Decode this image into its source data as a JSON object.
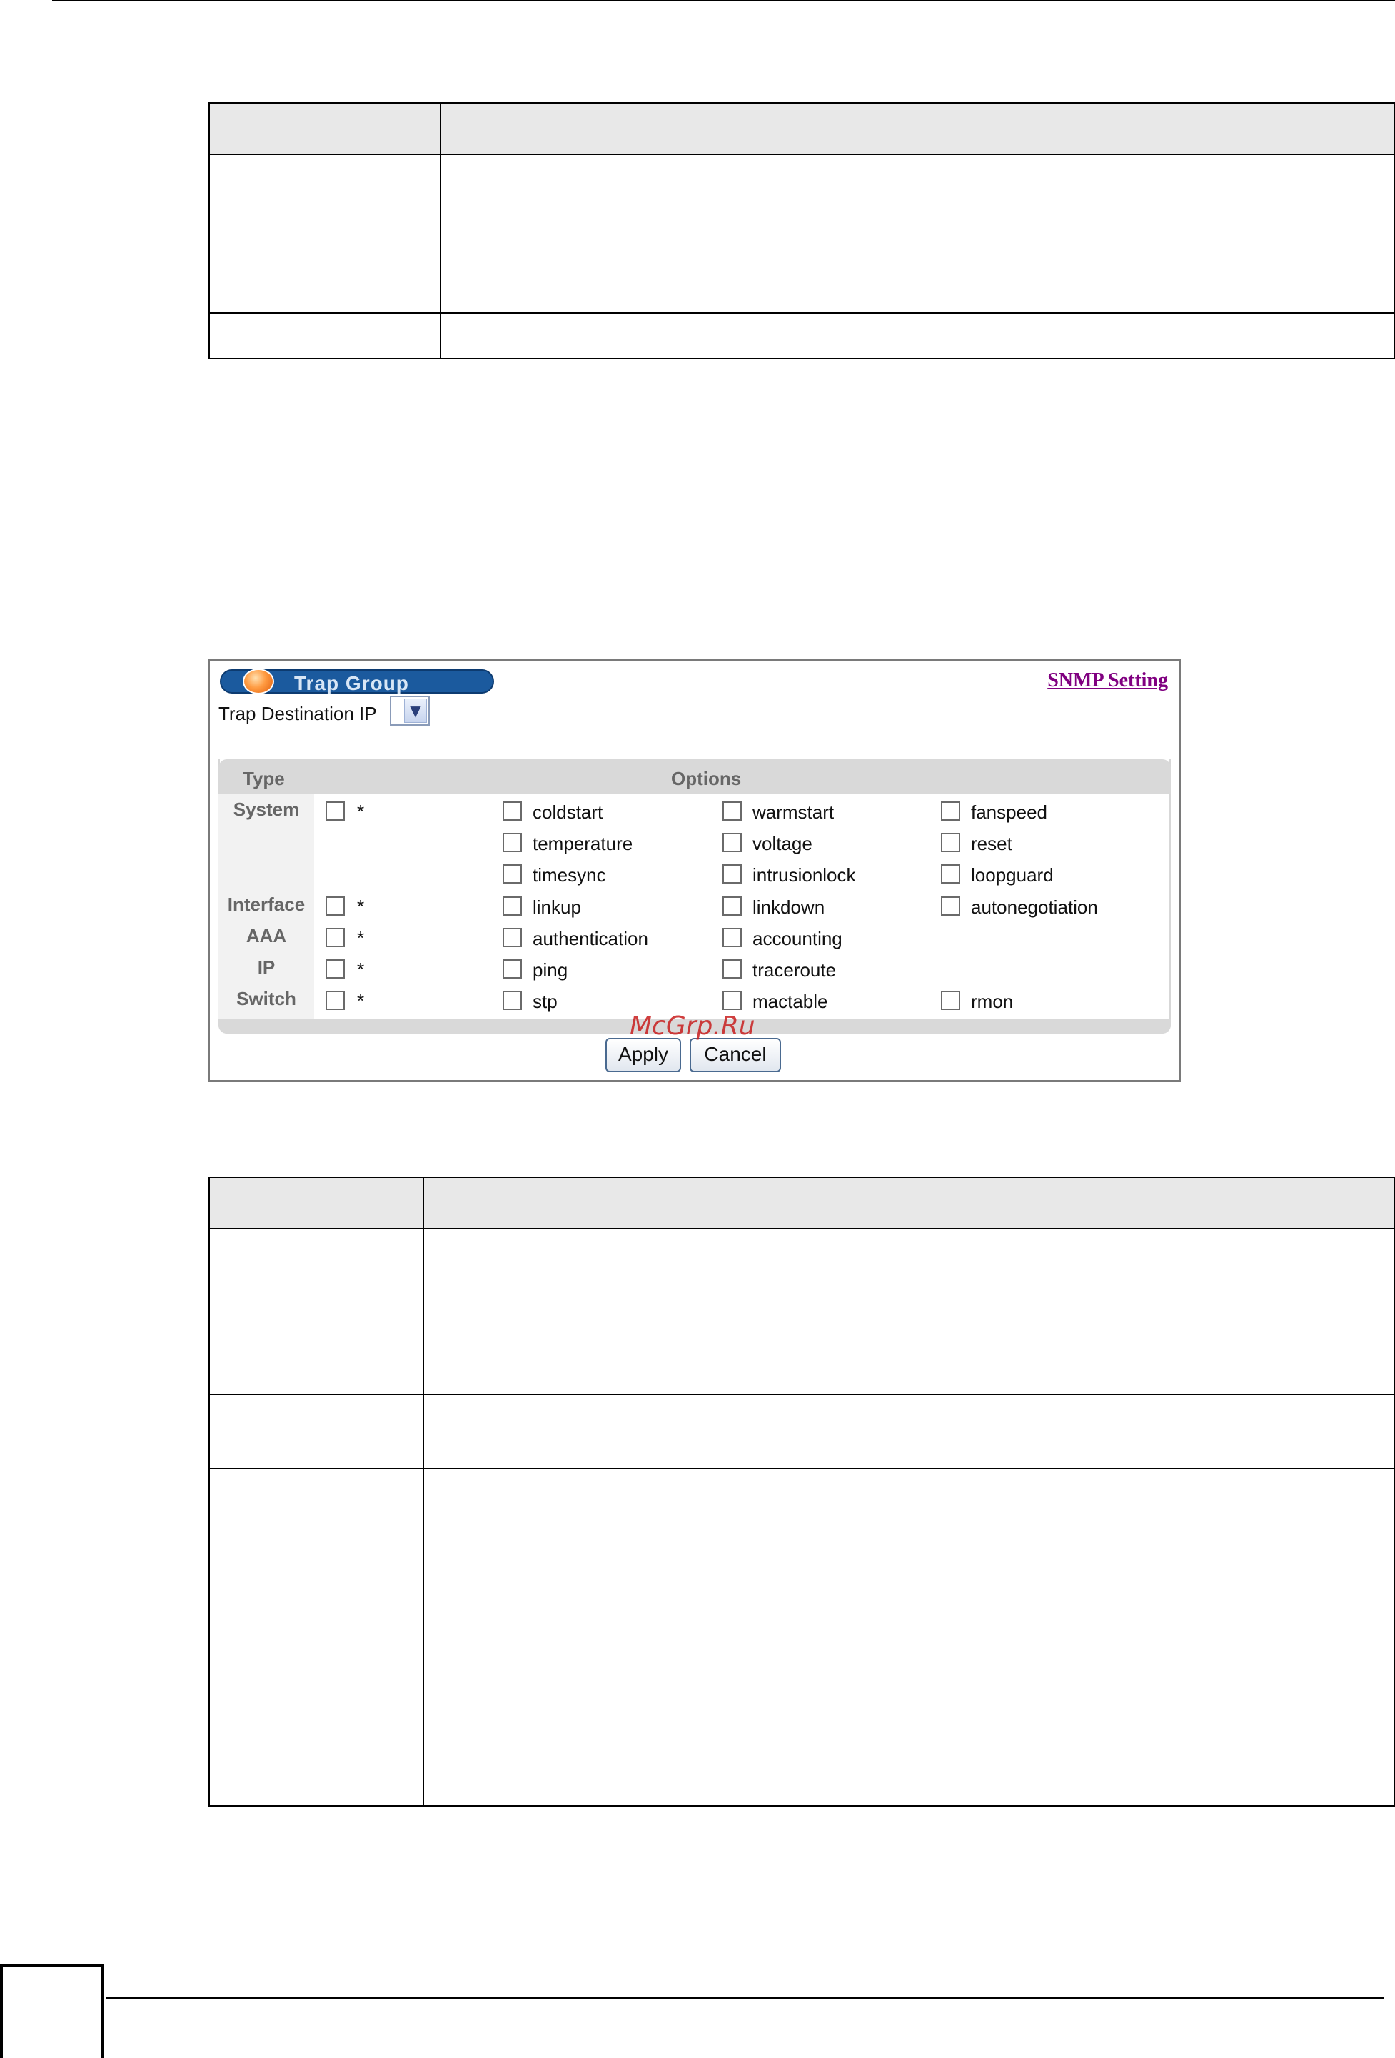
{
  "trap_panel": {
    "title": "Trap Group",
    "snmp_link": "SNMP Setting",
    "destination_label": "Trap Destination IP",
    "headers": {
      "type": "Type",
      "options": "Options"
    },
    "rows": [
      {
        "type": "System",
        "all": "*",
        "options": [
          [
            "coldstart",
            "warmstart",
            "fanspeed"
          ],
          [
            "temperature",
            "voltage",
            "reset"
          ],
          [
            "timesync",
            "intrusionlock",
            "loopguard"
          ]
        ]
      },
      {
        "type": "Interface",
        "all": "*",
        "options": [
          [
            "linkup",
            "linkdown",
            "autonegotiation"
          ]
        ]
      },
      {
        "type": "AAA",
        "all": "*",
        "options": [
          [
            "authentication",
            "accounting"
          ]
        ]
      },
      {
        "type": "IP",
        "all": "*",
        "options": [
          [
            "ping",
            "traceroute"
          ]
        ]
      },
      {
        "type": "Switch",
        "all": "*",
        "options": [
          [
            "stp",
            "mactable",
            "rmon"
          ]
        ]
      }
    ],
    "apply_label": "Apply",
    "cancel_label": "Cancel"
  },
  "watermark": "McGrp.Ru"
}
